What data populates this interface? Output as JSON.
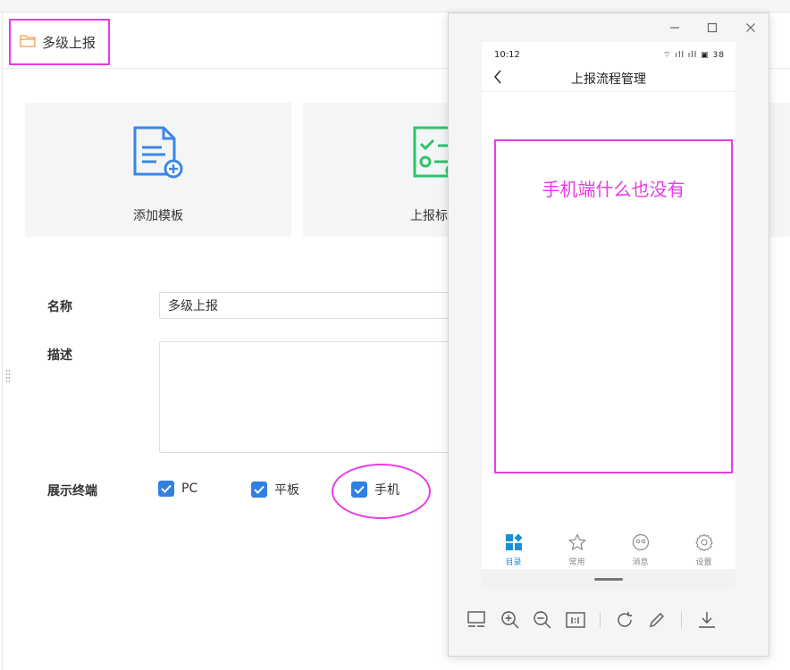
{
  "header": {
    "title": "多级上报"
  },
  "cards": [
    {
      "label": "添加模板"
    },
    {
      "label": "上报标"
    }
  ],
  "form": {
    "name_label": "名称",
    "name_value": "多级上报",
    "desc_label": "描述",
    "desc_value": "",
    "terminal_label": "展示终端",
    "terminals": [
      {
        "label": "PC",
        "checked": true
      },
      {
        "label": "平板",
        "checked": true
      },
      {
        "label": "手机",
        "checked": true
      }
    ]
  },
  "phone": {
    "status_time": "10:12",
    "status_icons": "⌔ ıll ıll ▣ 38",
    "nav_title": "上报流程管理",
    "annotation": "手机端什么也没有",
    "tabs": [
      {
        "label": "目录",
        "icon": "grid-icon",
        "active": true
      },
      {
        "label": "常用",
        "icon": "star-icon",
        "active": false
      },
      {
        "label": "消息",
        "icon": "message-icon",
        "active": false
      },
      {
        "label": "设置",
        "icon": "gear-icon",
        "active": false
      }
    ]
  },
  "colors": {
    "accent": "#2f7fe5",
    "annotation": "#e83be6",
    "card_bg": "#f4f5f7",
    "tab_active": "#1a8fd8"
  }
}
